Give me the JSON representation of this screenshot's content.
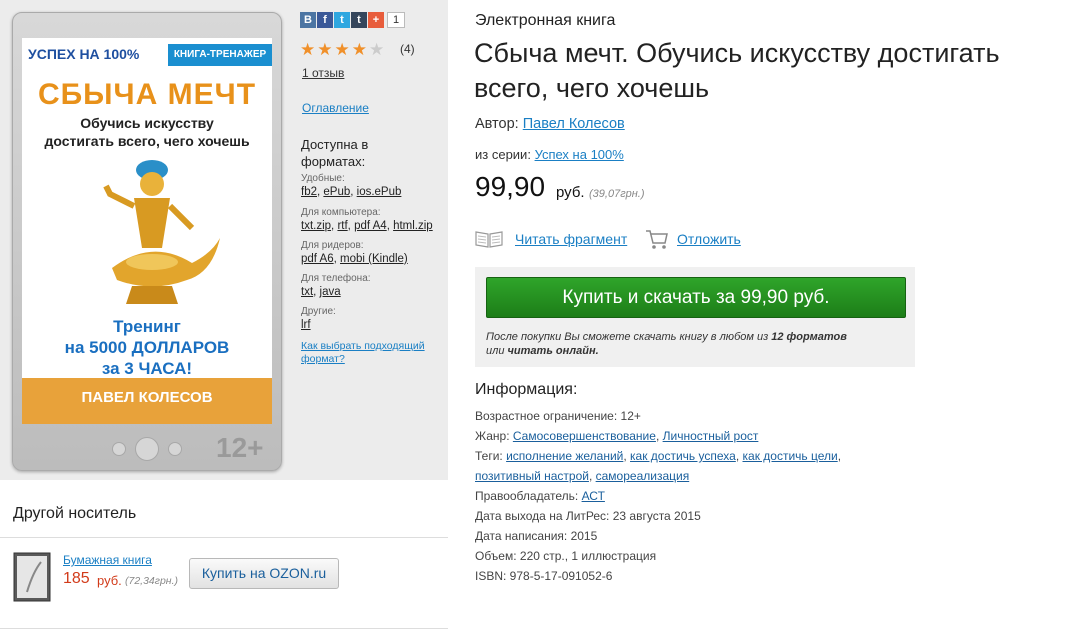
{
  "cover": {
    "series_text": "УСПЕХ НА 100%",
    "badge": "КНИГА-ТРЕНАЖЕР",
    "title": "СБЫЧА МЕЧТ",
    "subtitle_1": "Обучись искусству",
    "subtitle_2": "достигать всего, чего хочешь",
    "promo_1": "Тренинг",
    "promo_2": "на 5000 ДОЛЛАРОВ",
    "promo_3": "за 3 ЧАСА!",
    "author": "ПАВЕЛ КОЛЕСОВ",
    "age_mark": "12+"
  },
  "share": {
    "icons": [
      "vk-icon",
      "facebook-icon",
      "twitter-icon",
      "tumblr-icon",
      "plus-icon"
    ],
    "count": "1"
  },
  "rating": {
    "stars_filled": 4,
    "stars_total": 5,
    "count": "(4)",
    "reviews": "1 отзыв"
  },
  "toc_link": "Оглавление",
  "formats": {
    "title": "Доступна в форматах:",
    "groups": [
      {
        "label": "Удобные:",
        "items": [
          "fb2",
          "ePub",
          "ios.ePub"
        ]
      },
      {
        "label": "Для компьютера:",
        "items": [
          "txt.zip",
          "rtf",
          "pdf A4",
          "html.zip"
        ]
      },
      {
        "label": "Для ридеров:",
        "items": [
          "pdf A6",
          "mobi (Kindle)"
        ]
      },
      {
        "label": "Для телефона:",
        "items": [
          "txt",
          "java"
        ]
      },
      {
        "label": "Другие:",
        "items": [
          "lrf"
        ]
      }
    ],
    "help_link": "Как выбрать подходящий формат?"
  },
  "product": {
    "kind": "Электронная книга",
    "title": "Сбыча мечт. Обучись искусству достигать всего, чего хочешь",
    "author_label": "Автор:",
    "author": "Павел Колесов",
    "series_label": "из серии:",
    "series": "Успех на 100%",
    "price": "99,90",
    "currency": "руб.",
    "price_alt": "(39,07грн.)"
  },
  "actions": {
    "read_fragment": "Читать фрагмент",
    "postpone": "Отложить",
    "buy": "Купить и скачать за 99,90 руб.",
    "note_1": "После покупки Вы сможете скачать книгу в любом из",
    "note_bold_1": "12 форматов",
    "note_2": "или",
    "note_bold_2": "читать онлайн."
  },
  "info": {
    "title": "Информация:",
    "age": "Возрастное ограничение: 12+",
    "genre_label": "Жанр:",
    "genres": [
      "Самосовершенствование",
      "Личностный рост"
    ],
    "tags_label": "Теги:",
    "tags": [
      "исполнение желаний",
      "как достичь успеха",
      "как достичь цели",
      "позитивный настрой",
      "самореализация"
    ],
    "rightholder_label": "Правообладатель:",
    "rightholder": "АСТ",
    "release": "Дата выхода на ЛитРес: 23 августа 2015",
    "written": "Дата написания: 2015",
    "volume": "Объем: 220 стр., 1 иллюстрация",
    "isbn": "ISBN: 978-5-17-091052-6"
  },
  "other": {
    "title": "Другой носитель",
    "paper_link": "Бумажная книга",
    "price": "185",
    "currency": "руб.",
    "price_alt": "(72,34грн.)",
    "ozon_button": "Купить на OZON.ru"
  }
}
